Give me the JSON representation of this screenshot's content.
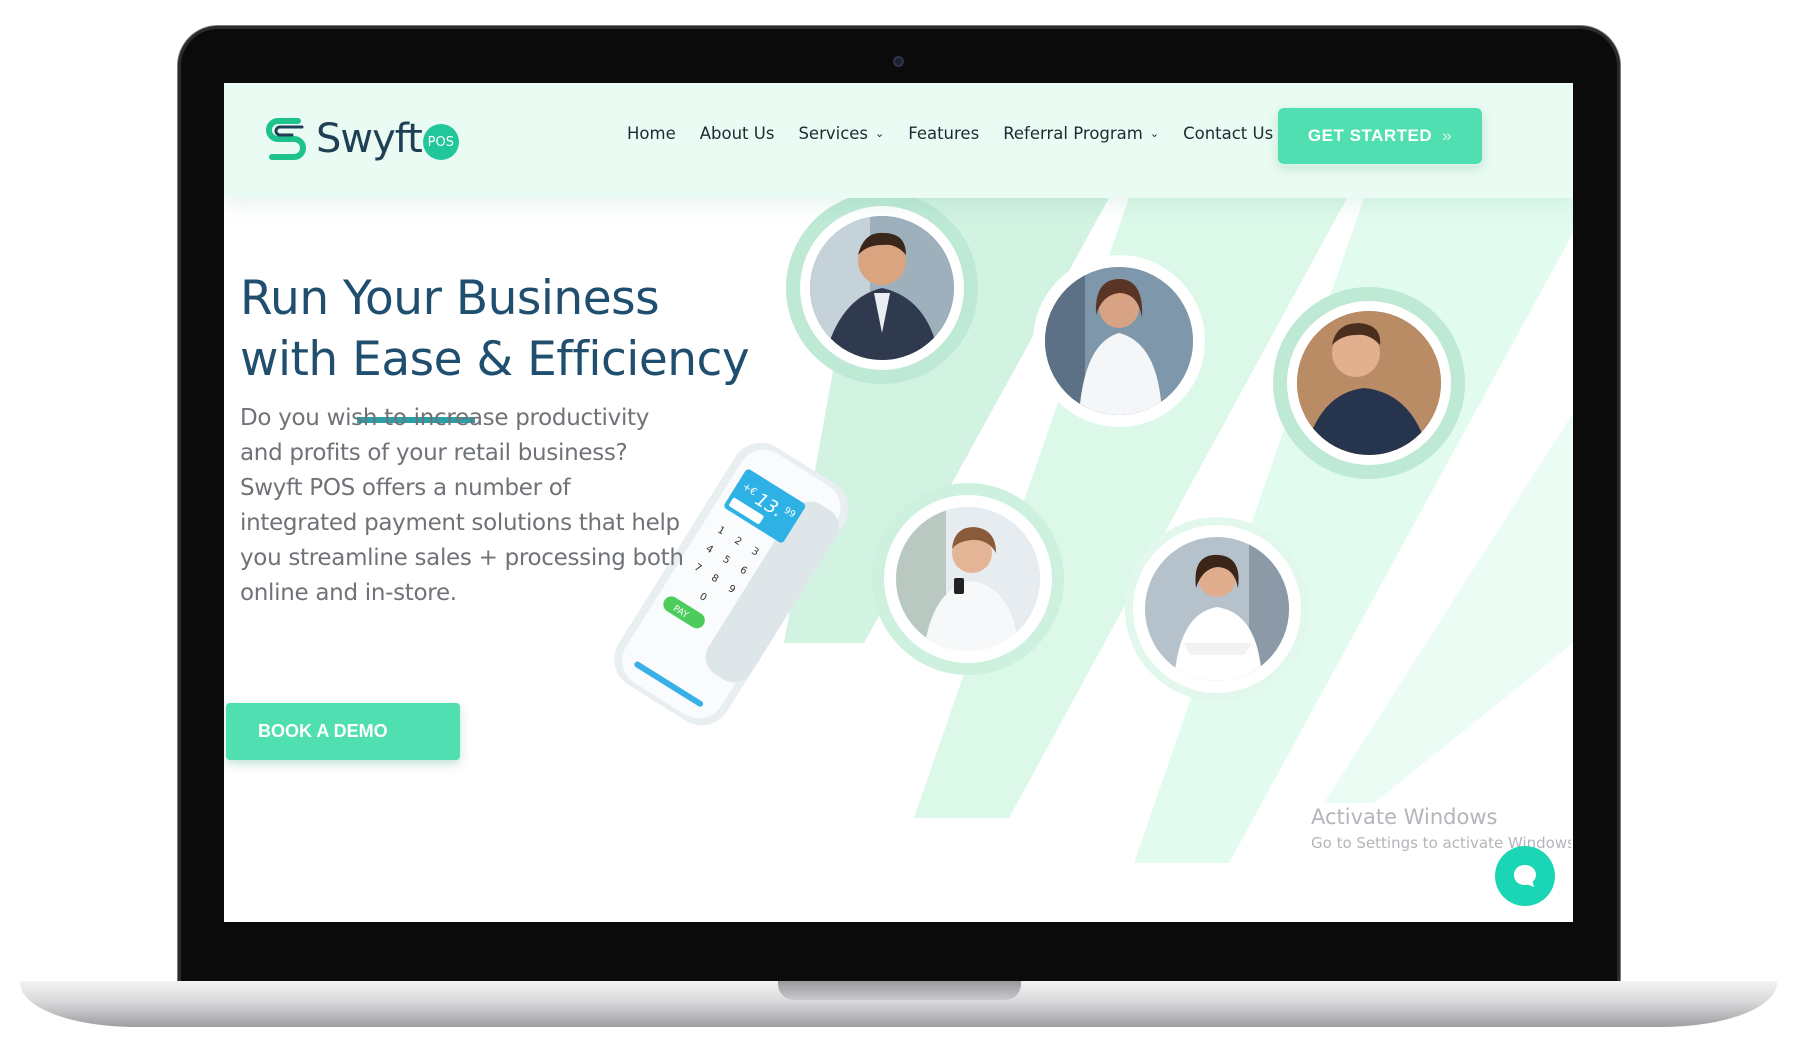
{
  "brand": {
    "name": "Swyft",
    "badge": "POS",
    "logo_icon": "swyft-s-logo-icon"
  },
  "nav": {
    "items": [
      {
        "label": "Home",
        "has_dropdown": false
      },
      {
        "label": "About Us",
        "has_dropdown": false
      },
      {
        "label": "Services",
        "has_dropdown": true
      },
      {
        "label": "Features",
        "has_dropdown": false
      },
      {
        "label": "Referral Program",
        "has_dropdown": true
      },
      {
        "label": "Contact Us",
        "has_dropdown": false
      }
    ],
    "dropdown_icon": "chevron-down-icon",
    "cta_label": "GET STARTED",
    "cta_icon": "double-chevron-right-icon"
  },
  "hero": {
    "title_line1": "Run Your Business",
    "title_line2_pre": "with ",
    "title_line2_highlight": "Ease",
    "title_line2_post": " & Efficiency",
    "body_lines": [
      "Do you wish to increase productivity",
      "and profits of your retail business?",
      "Swyft POS offers a number of",
      "integrated payment solutions that help",
      "you streamline sales + processing both",
      "online and in-store."
    ],
    "cta_label": "BOOK A DEMO"
  },
  "device": {
    "amount": "13.",
    "cents": "99",
    "currency": "+€",
    "pay_label": "PAY",
    "keys": [
      "1",
      "2",
      "3",
      "4",
      "5",
      "6",
      "7",
      "8",
      "9",
      "0"
    ]
  },
  "watermark": {
    "title": "Activate Windows",
    "subtitle": "Go to Settings to activate Windows."
  },
  "chat": {
    "icon": "chat-bubble-icon"
  },
  "colors": {
    "accent": "#4fdfb0",
    "header_bg": "#e9fbf2",
    "title": "#1f4e6f",
    "underline": "#2a9fa7",
    "chat": "#1bd6b4"
  }
}
